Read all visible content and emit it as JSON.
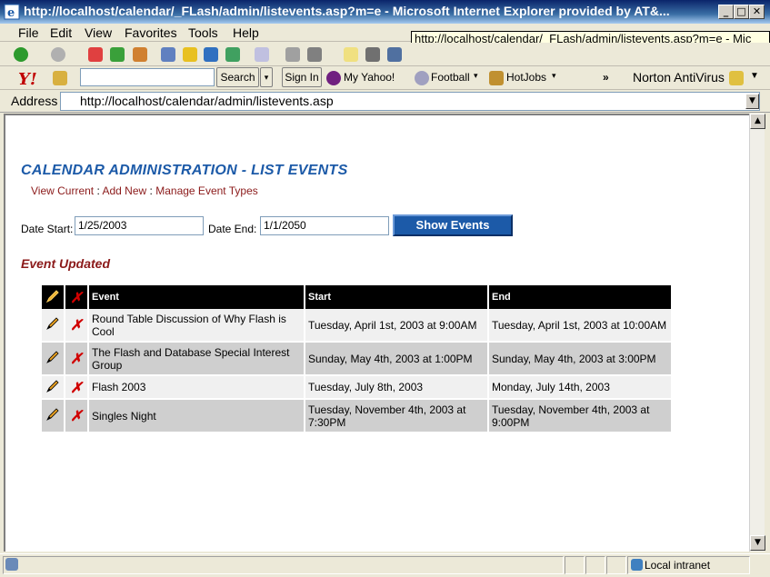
{
  "window": {
    "title": "http://localhost/calendar/_FLash/admin/listevents.asp?m=e - Microsoft Internet Explorer provided by AT&..."
  },
  "tooltip": "http://localhost/calendar/_FLash/admin/listevents.asp?m=e - Mic",
  "menu": [
    "File",
    "Edit",
    "View",
    "Favorites",
    "Tools",
    "Help"
  ],
  "yahoo_toolbar": {
    "search_label": "Search",
    "signin_label": "Sign In",
    "my_yahoo": "My Yahoo!",
    "football": "Football",
    "hotjobs": "HotJobs",
    "more": "»",
    "norton": "Norton AntiVirus"
  },
  "address": {
    "label": "Address",
    "url": "http://localhost/calendar/admin/listevents.asp"
  },
  "page": {
    "heading": "CALENDAR ADMINISTRATION - LIST EVENTS",
    "links": {
      "view_current": "View Current",
      "add_new": "Add New",
      "manage_types": "Manage Event Types",
      "separator": ":"
    },
    "date_start_label": "Date Start:",
    "date_start_value": "1/25/2003",
    "date_end_label": "Date End:",
    "date_end_value": "1/1/2050",
    "show_button": "Show Events",
    "message": "Event Updated",
    "table": {
      "headers": {
        "event": "Event",
        "start": "Start",
        "end": "End"
      },
      "rows": [
        {
          "event": "Round Table Discussion of Why Flash is Cool",
          "start": "Tuesday, April 1st, 2003 at 9:00AM",
          "end": "Tuesday, April 1st, 2003 at 10:00AM"
        },
        {
          "event": "The Flash and Database Special Interest Group",
          "start": "Sunday, May 4th, 2003 at 1:00PM",
          "end": "Sunday, May 4th, 2003 at 3:00PM"
        },
        {
          "event": "Flash 2003",
          "start": "Tuesday, July 8th, 2003",
          "end": "Monday, July 14th, 2003"
        },
        {
          "event": "Singles Night",
          "start": "Tuesday, November 4th, 2003 at 7:30PM",
          "end": "Tuesday, November 4th, 2003 at 9:00PM"
        }
      ]
    }
  },
  "status": {
    "zone": "Local intranet"
  }
}
